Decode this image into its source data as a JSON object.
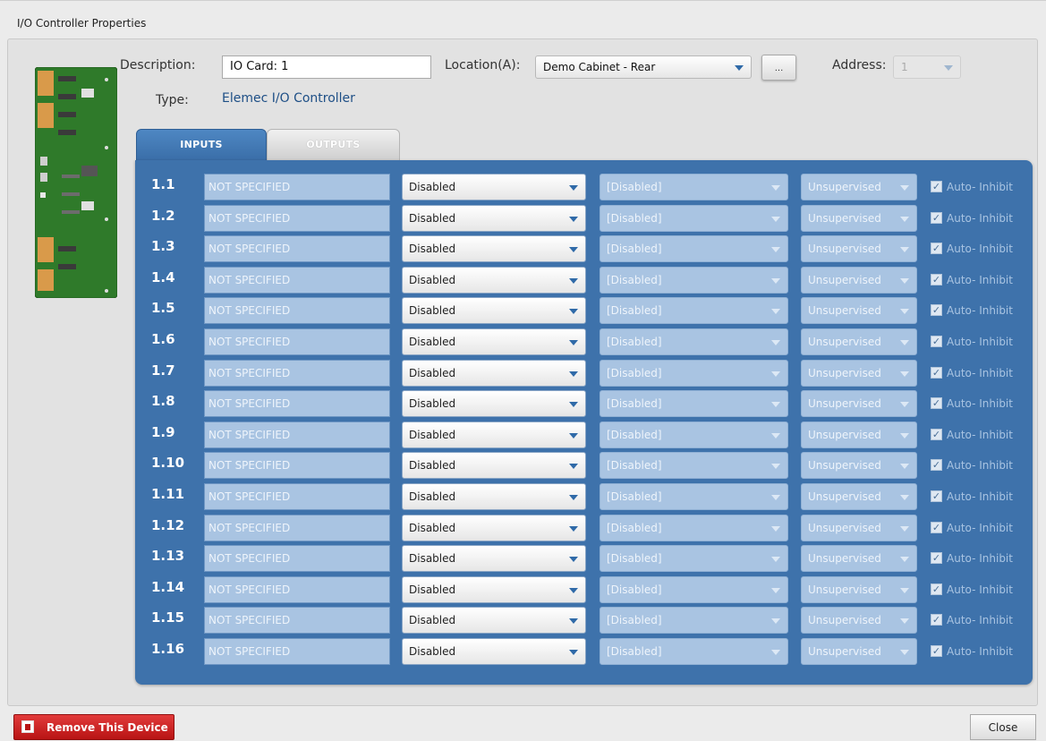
{
  "window": {
    "title": "I/O Controller Properties"
  },
  "header": {
    "description_label": "Description:",
    "description_value": "IO Card: 1",
    "type_label": "Type:",
    "type_value": "Elemec I/O Controller",
    "location_label": "Location(A):",
    "location_value": "Demo Cabinet - Rear",
    "browse_label": "...",
    "address_label": "Address:",
    "address_value": "1"
  },
  "tabs": [
    {
      "label": "INPUTS",
      "active": true
    },
    {
      "label": "OUTPUTS",
      "active": false
    }
  ],
  "rows": [
    {
      "id": "1.1",
      "name": "NOT SPECIFIED",
      "mode": "Disabled",
      "action": "[Disabled]",
      "supervision": "Unsupervised",
      "auto_inhibit": "Auto- Inhibit",
      "checked": true
    },
    {
      "id": "1.2",
      "name": "NOT SPECIFIED",
      "mode": "Disabled",
      "action": "[Disabled]",
      "supervision": "Unsupervised",
      "auto_inhibit": "Auto- Inhibit",
      "checked": true
    },
    {
      "id": "1.3",
      "name": "NOT SPECIFIED",
      "mode": "Disabled",
      "action": "[Disabled]",
      "supervision": "Unsupervised",
      "auto_inhibit": "Auto- Inhibit",
      "checked": true
    },
    {
      "id": "1.4",
      "name": "NOT SPECIFIED",
      "mode": "Disabled",
      "action": "[Disabled]",
      "supervision": "Unsupervised",
      "auto_inhibit": "Auto- Inhibit",
      "checked": true
    },
    {
      "id": "1.5",
      "name": "NOT SPECIFIED",
      "mode": "Disabled",
      "action": "[Disabled]",
      "supervision": "Unsupervised",
      "auto_inhibit": "Auto- Inhibit",
      "checked": true
    },
    {
      "id": "1.6",
      "name": "NOT SPECIFIED",
      "mode": "Disabled",
      "action": "[Disabled]",
      "supervision": "Unsupervised",
      "auto_inhibit": "Auto- Inhibit",
      "checked": true
    },
    {
      "id": "1.7",
      "name": "NOT SPECIFIED",
      "mode": "Disabled",
      "action": "[Disabled]",
      "supervision": "Unsupervised",
      "auto_inhibit": "Auto- Inhibit",
      "checked": true
    },
    {
      "id": "1.8",
      "name": "NOT SPECIFIED",
      "mode": "Disabled",
      "action": "[Disabled]",
      "supervision": "Unsupervised",
      "auto_inhibit": "Auto- Inhibit",
      "checked": true
    },
    {
      "id": "1.9",
      "name": "NOT SPECIFIED",
      "mode": "Disabled",
      "action": "[Disabled]",
      "supervision": "Unsupervised",
      "auto_inhibit": "Auto- Inhibit",
      "checked": true
    },
    {
      "id": "1.10",
      "name": "NOT SPECIFIED",
      "mode": "Disabled",
      "action": "[Disabled]",
      "supervision": "Unsupervised",
      "auto_inhibit": "Auto- Inhibit",
      "checked": true
    },
    {
      "id": "1.11",
      "name": "NOT SPECIFIED",
      "mode": "Disabled",
      "action": "[Disabled]",
      "supervision": "Unsupervised",
      "auto_inhibit": "Auto- Inhibit",
      "checked": true
    },
    {
      "id": "1.12",
      "name": "NOT SPECIFIED",
      "mode": "Disabled",
      "action": "[Disabled]",
      "supervision": "Unsupervised",
      "auto_inhibit": "Auto- Inhibit",
      "checked": true
    },
    {
      "id": "1.13",
      "name": "NOT SPECIFIED",
      "mode": "Disabled",
      "action": "[Disabled]",
      "supervision": "Unsupervised",
      "auto_inhibit": "Auto- Inhibit",
      "checked": true
    },
    {
      "id": "1.14",
      "name": "NOT SPECIFIED",
      "mode": "Disabled",
      "action": "[Disabled]",
      "supervision": "Unsupervised",
      "auto_inhibit": "Auto- Inhibit",
      "checked": true
    },
    {
      "id": "1.15",
      "name": "NOT SPECIFIED",
      "mode": "Disabled",
      "action": "[Disabled]",
      "supervision": "Unsupervised",
      "auto_inhibit": "Auto- Inhibit",
      "checked": true
    },
    {
      "id": "1.16",
      "name": "NOT SPECIFIED",
      "mode": "Disabled",
      "action": "[Disabled]",
      "supervision": "Unsupervised",
      "auto_inhibit": "Auto- Inhibit",
      "checked": true
    }
  ],
  "footer": {
    "remove_label": "Remove This Device",
    "close_label": "Close"
  },
  "colors": {
    "panel_blue": "#3e72ab",
    "danger_red": "#c81e1e",
    "board_green": "#2f7a2a",
    "type_link": "#1e4f86"
  }
}
